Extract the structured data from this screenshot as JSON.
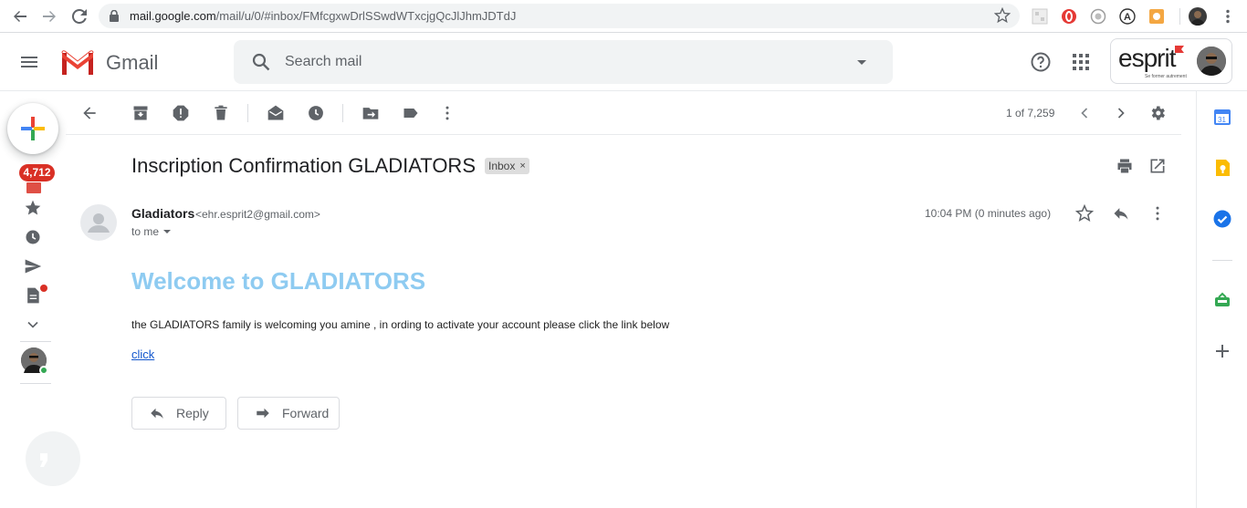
{
  "browser": {
    "url_host": "mail.google.com",
    "url_path": "/mail/u/0/#inbox/FMfcgxwDrlSSwdWTxcjgQcJlJhmJDTdJ"
  },
  "header": {
    "app_name": "Gmail",
    "search_placeholder": "Search mail",
    "account_brand": "esprit",
    "account_tagline": "Se former autrement"
  },
  "left_rail": {
    "inbox_count": "4,712"
  },
  "toolbar": {
    "page_count": "1 of 7,259"
  },
  "message": {
    "subject": "Inscription Confirmation GLADIATORS",
    "label": "Inbox",
    "label_remove": "×",
    "sender_name": "Gladiators",
    "sender_email": "<ehr.esprit2@gmail.com>",
    "recipient": "to me",
    "time": "10:04 PM (0 minutes ago)",
    "heading": "Welcome to GLADIATORS",
    "body": "the GLADIATORS family is welcoming you amine , in ording to activate your account please click the link below",
    "link_text": "click"
  },
  "actions": {
    "reply_label": "Reply",
    "forward_label": "Forward"
  },
  "side_panel": {
    "calendar_day": "31"
  },
  "colors": {
    "heading": "#8ecbf1",
    "link": "#1155cc",
    "badge": "#d93025"
  }
}
